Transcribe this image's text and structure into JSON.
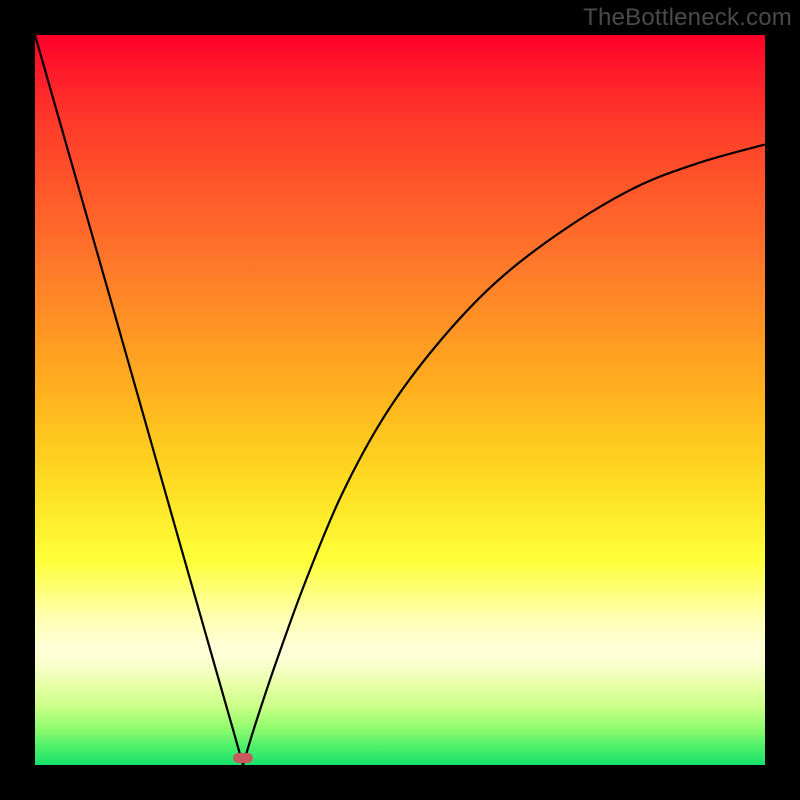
{
  "attribution": "TheBottleneck.com",
  "colors": {
    "frame": "#000000",
    "curve": "#000000",
    "dot": "#c65a5c",
    "gradient_top": "#ff0029",
    "gradient_bottom": "#16e26c"
  },
  "chart_data": {
    "type": "line",
    "title": "",
    "xlabel": "",
    "ylabel": "",
    "xlim": [
      0,
      1
    ],
    "ylim": [
      0,
      1
    ],
    "grid": false,
    "legend": false,
    "annotations": [
      "TheBottleneck.com"
    ],
    "note": "A V-shaped curve over a red-to-green vertical gradient. Minimum (touching bottom) at x≈0.285. Left branch rises steeply to the top-left corner; right branch rises with decreasing slope, exiting the right edge near y≈0.85.",
    "series": [
      {
        "name": "curve",
        "x": [
          0.0,
          0.05,
          0.1,
          0.15,
          0.2,
          0.24,
          0.27,
          0.285,
          0.3,
          0.33,
          0.37,
          0.42,
          0.48,
          0.55,
          0.63,
          0.72,
          0.82,
          0.91,
          1.0
        ],
        "y": [
          1.0,
          0.825,
          0.65,
          0.474,
          0.298,
          0.158,
          0.053,
          0.0,
          0.05,
          0.14,
          0.25,
          0.37,
          0.48,
          0.575,
          0.66,
          0.73,
          0.79,
          0.825,
          0.85
        ]
      }
    ],
    "marker": {
      "x": 0.285,
      "y": 0.0,
      "shape": "pill",
      "color": "#c65a5c"
    }
  }
}
